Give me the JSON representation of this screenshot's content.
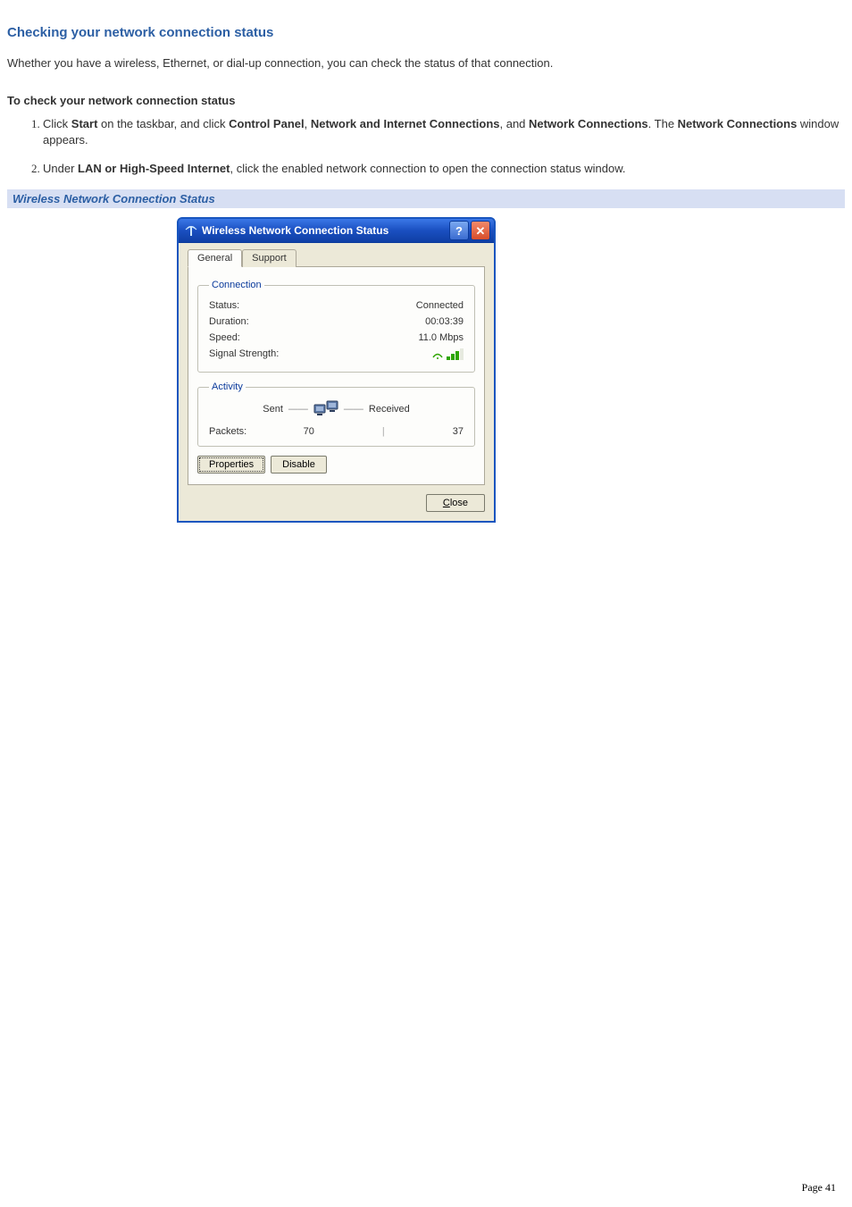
{
  "heading": "Checking your network connection status",
  "intro": "Whether you have a wireless, Ethernet, or dial-up connection, you can check the status of that connection.",
  "subhead": "To check your network connection status",
  "steps": {
    "s1": {
      "p1": "Click ",
      "b1": "Start",
      "p2": " on the taskbar, and click ",
      "b2": "Control Panel",
      "p3": ", ",
      "b3": "Network and Internet Connections",
      "p4": ", and ",
      "b4": "Network Connections",
      "p5": ". The ",
      "b5": "Network Connections",
      "p6": " window appears."
    },
    "s2": {
      "p1": "Under ",
      "b1": "LAN or High-Speed Internet",
      "p2": ", click the enabled network connection to open the connection status window."
    }
  },
  "figcap": "Wireless Network Connection Status",
  "dialog": {
    "title": "Wireless Network Connection Status",
    "tabs": {
      "general": "General",
      "support": "Support"
    },
    "connection": {
      "legend": "Connection",
      "status_l": "Status:",
      "status_v": "Connected",
      "duration_l": "Duration:",
      "duration_v": "00:03:39",
      "speed_l": "Speed:",
      "speed_v": "11.0 Mbps",
      "signal_l": "Signal Strength:"
    },
    "activity": {
      "legend": "Activity",
      "sent": "Sent",
      "received": "Received",
      "packets_l": "Packets:",
      "sent_v": "70",
      "recv_v": "37"
    },
    "buttons": {
      "properties": "Properties",
      "disable": "Disable",
      "close_pre": "C",
      "close_rest": "lose"
    }
  },
  "page_label": "Page 41"
}
